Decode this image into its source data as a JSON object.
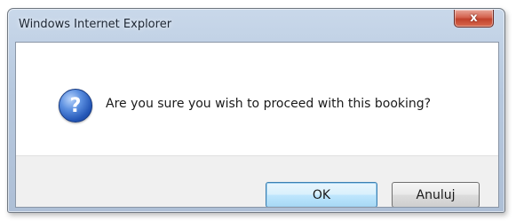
{
  "window": {
    "title": "Windows Internet Explorer",
    "close_label": "x"
  },
  "dialog": {
    "icon": "question-icon",
    "icon_glyph": "?",
    "message": "Are you sure you wish to proceed with this booking?"
  },
  "buttons": {
    "ok_label": "OK",
    "cancel_label": "Anuluj"
  }
}
